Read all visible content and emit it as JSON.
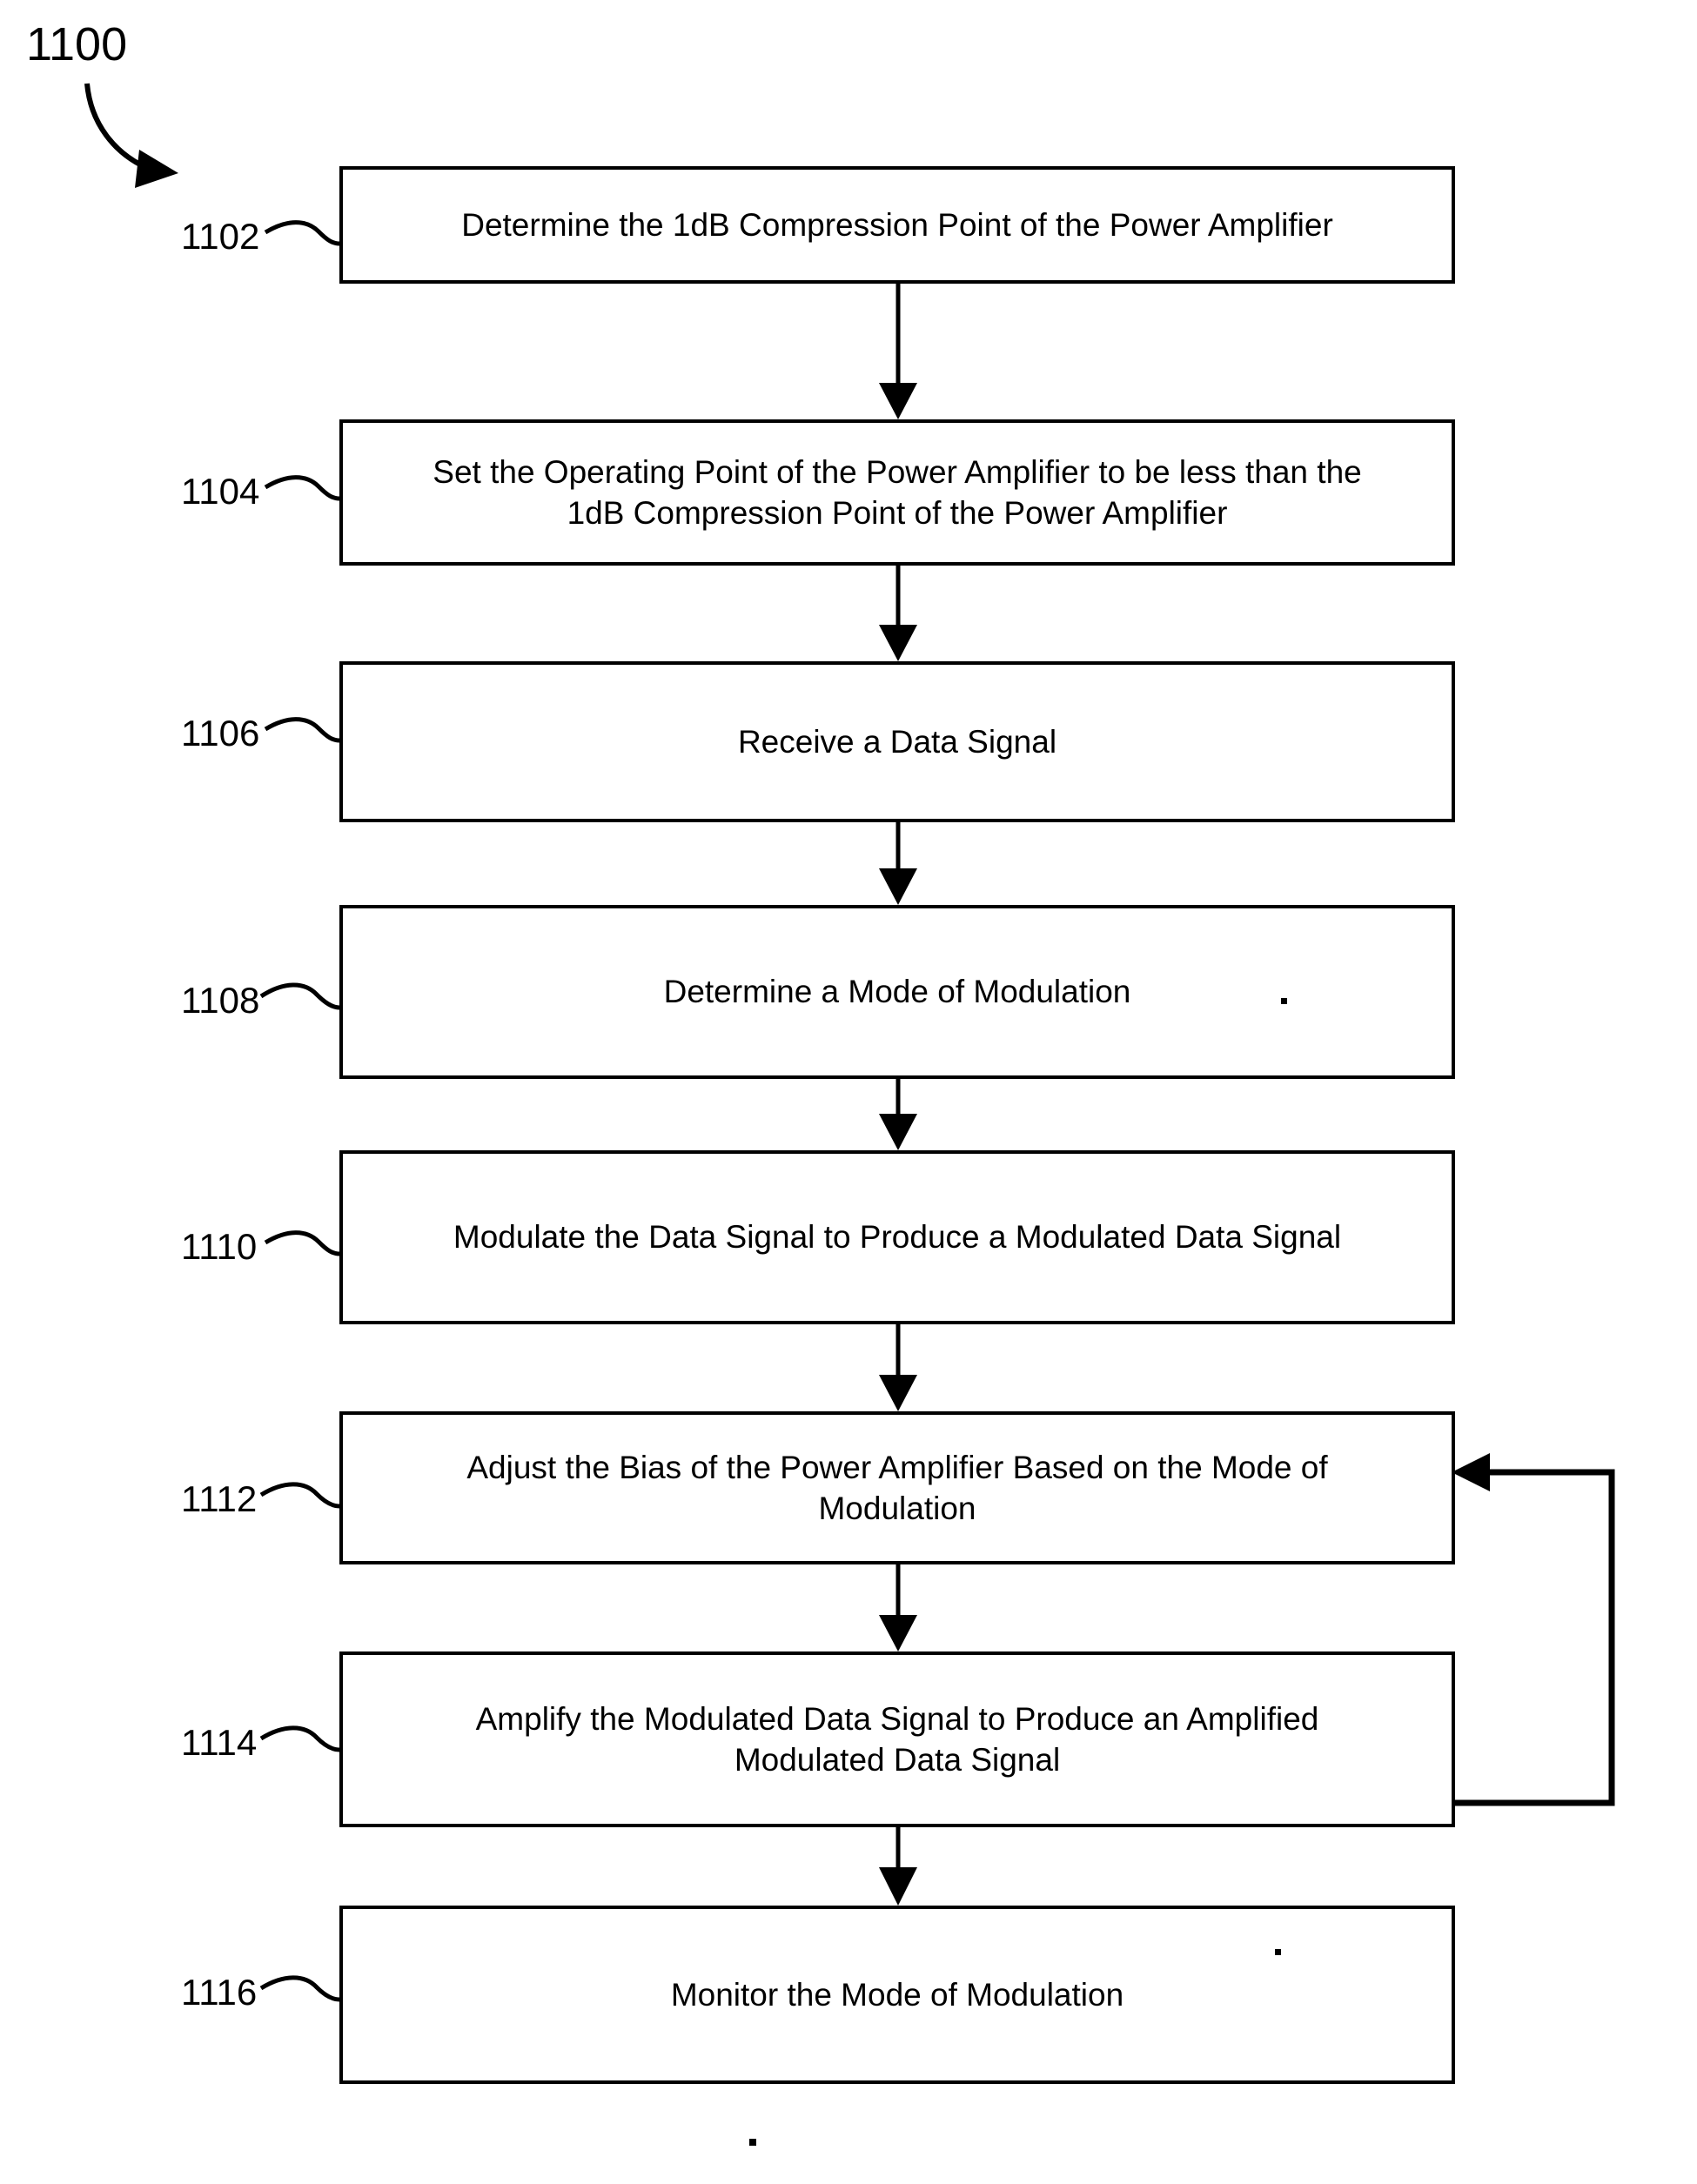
{
  "figure": {
    "number": "1100",
    "title_label": "1100",
    "pointer_icon": "curved-arrow-icon"
  },
  "colors": {
    "stroke": "#000000",
    "background": "#ffffff",
    "text": "#000000"
  },
  "chart_data": {
    "type": "flowchart",
    "title": "1100",
    "orientation": "vertical",
    "nodes": [
      {
        "ref": "1102",
        "label": "Determine the 1dB Compression Point of the Power Amplifier"
      },
      {
        "ref": "1104",
        "label": "Set the Operating Point of the Power Amplifier to be less than the\n1dB Compression Point of the Power Amplifier"
      },
      {
        "ref": "1106",
        "label": "Receive a Data Signal"
      },
      {
        "ref": "1108",
        "label": "Determine a Mode of Modulation"
      },
      {
        "ref": "1110",
        "label": "Modulate the Data Signal to Produce a Modulated Data Signal"
      },
      {
        "ref": "1112",
        "label": "Adjust the Bias of the Power Amplifier Based on the Mode of\nModulation"
      },
      {
        "ref": "1114",
        "label": "Amplify the Modulated Data Signal to Produce an Amplified\nModulated Data Signal"
      },
      {
        "ref": "1116",
        "label": "Monitor the Mode of Modulation"
      }
    ],
    "edges": [
      {
        "from": "1102",
        "to": "1104",
        "kind": "arrow-down"
      },
      {
        "from": "1104",
        "to": "1106",
        "kind": "arrow-down"
      },
      {
        "from": "1106",
        "to": "1108",
        "kind": "arrow-down"
      },
      {
        "from": "1108",
        "to": "1110",
        "kind": "arrow-down"
      },
      {
        "from": "1110",
        "to": "1112",
        "kind": "arrow-down"
      },
      {
        "from": "1112",
        "to": "1114",
        "kind": "arrow-down"
      },
      {
        "from": "1114",
        "to": "1116",
        "kind": "arrow-down"
      },
      {
        "from": "1116",
        "to": "1112",
        "kind": "feedback-loop-right"
      }
    ]
  },
  "steps": [
    {
      "ref": "1102",
      "label": "Determine the 1dB Compression Point of the Power Amplifier"
    },
    {
      "ref": "1104",
      "label": "Set the Operating Point of the Power Amplifier to be less than the\n1dB Compression Point of the Power Amplifier"
    },
    {
      "ref": "1106",
      "label": "Receive a Data Signal"
    },
    {
      "ref": "1108",
      "label": "Determine a Mode of Modulation"
    },
    {
      "ref": "1110",
      "label": "Modulate the Data Signal to Produce a Modulated Data Signal"
    },
    {
      "ref": "1112",
      "label": "Adjust the Bias of the Power Amplifier Based on the Mode of\nModulation"
    },
    {
      "ref": "1114",
      "label": "Amplify the Modulated Data Signal to Produce an Amplified\nModulated Data Signal"
    },
    {
      "ref": "1116",
      "label": "Monitor the Mode of Modulation"
    }
  ]
}
